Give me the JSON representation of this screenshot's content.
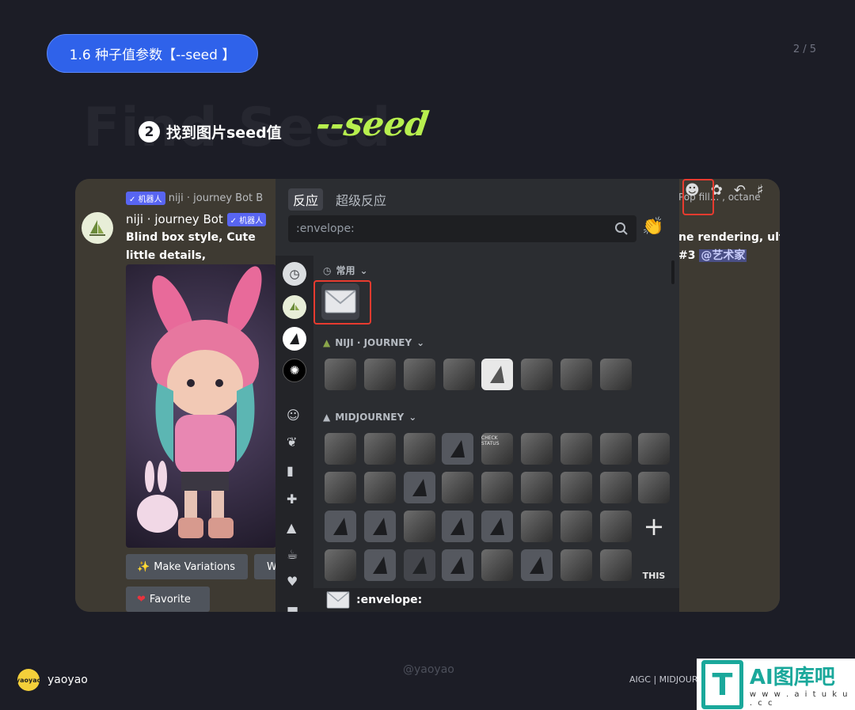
{
  "header": {
    "pill_label": "1.6 种子值参数【--seed 】",
    "page": "2 / 5",
    "bg_word": "Find Seed",
    "step_number": "2",
    "step_title": "找到图片seed值",
    "seed_word": "--seed"
  },
  "chat": {
    "reply_tag": "✓ 机器人",
    "reply_text": "niji · journey Bot B",
    "username": "niji · journey Bot",
    "bot_tag": "✓ 机器人",
    "message_left": "Blind box style, Cute little details, edgelighting, chibi",
    "message_right": "ne rendering, ultra",
    "message_right2": "#3",
    "mention": "@艺术家",
    "time_hint": "Pop fill... , octane",
    "buttons": {
      "make_variations": "Make Variations",
      "w": "W",
      "favorite": "Favorite"
    }
  },
  "picker": {
    "tab_reactions": "反应",
    "tab_super": "超级反应",
    "search_value": ":envelope:",
    "section_frequent": "常用",
    "section_niji": "NIJI · JOURNEY",
    "section_mid": "MIDJOURNEY",
    "footer_name": ":envelope:",
    "icons": {
      "envelope": "✉",
      "clap": "👏",
      "plus": "+",
      "this": "THIS",
      "check": "CHECK STATUS"
    }
  },
  "footer": {
    "brand": "yaoyao",
    "watermark": "@yaoyao",
    "aigc": "AIGC | MIDJOUR",
    "logo_text": "AI图库吧",
    "logo_url": "w w w . a i t u k u . c c",
    "logo_mark": "T",
    "logo_avatar": "yaoyao"
  }
}
